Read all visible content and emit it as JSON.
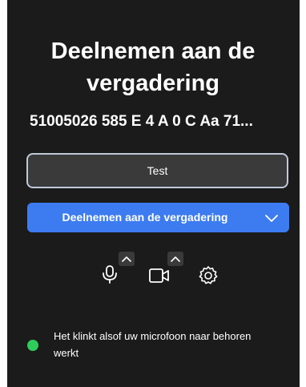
{
  "dialog": {
    "title": "Deelnemen aan de vergadering",
    "meeting_id": "51005026 585 E 4 A 0 C Aa 71...",
    "name_value": "Test"
  },
  "join": {
    "label": "Deelnemen aan de vergadering",
    "dropdown_icon": "chevron-down-icon"
  },
  "controls": {
    "microphone_icon": "microphone-icon",
    "camera_icon": "camera-icon",
    "settings_icon": "gear-icon"
  },
  "status": {
    "text": "Het klinkt alsof uw microfoon naar behoren werkt",
    "color": "#2ecc5b"
  },
  "colors": {
    "background": "#1b1b1b",
    "accent": "#3d7cf0",
    "input_bg": "#3a3a3a",
    "input_border": "#bfc9d9"
  }
}
